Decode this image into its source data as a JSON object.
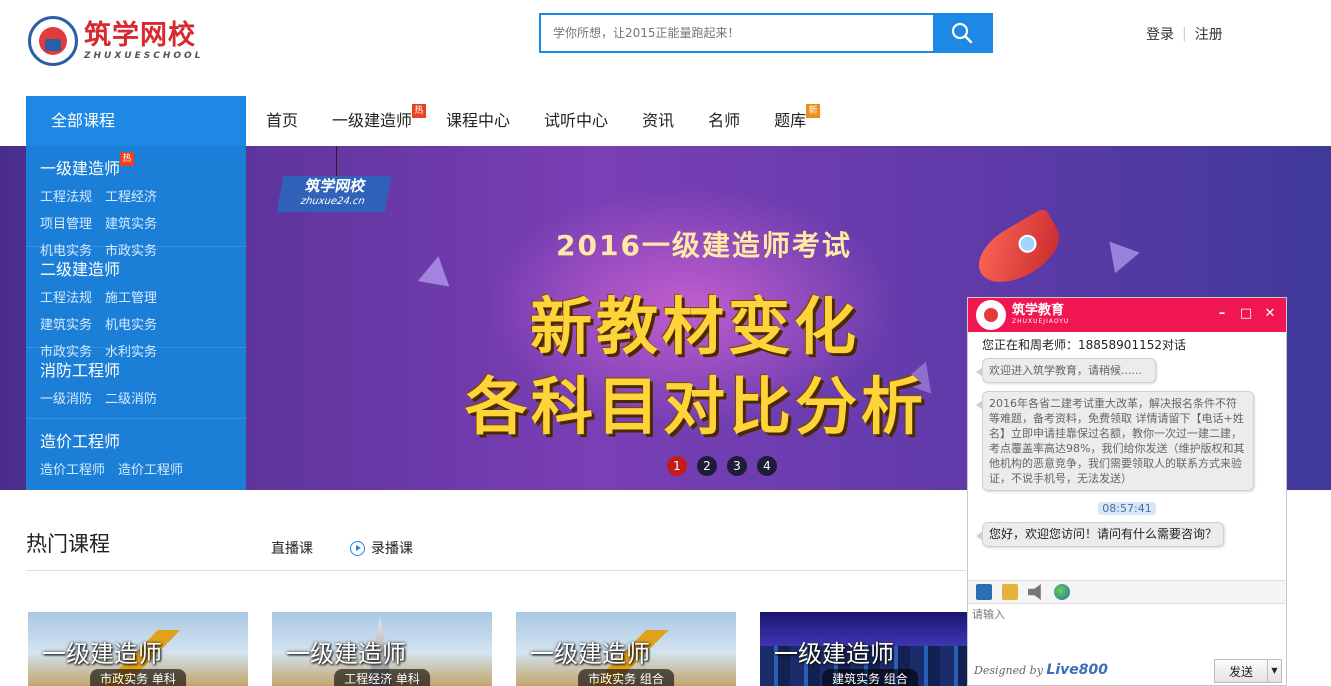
{
  "header": {
    "logo_cn": "筑学网校",
    "logo_en": "ZHUXUESCHOOL",
    "search_placeholder": "学你所想，让2015正能量跑起来！",
    "login": "登录",
    "register": "注册"
  },
  "nav": {
    "all_courses": "全部课程",
    "items": [
      {
        "label": "首页"
      },
      {
        "label": "一级建造师",
        "badge": "热"
      },
      {
        "label": "课程中心"
      },
      {
        "label": "试听中心"
      },
      {
        "label": "资讯"
      },
      {
        "label": "名师"
      },
      {
        "label": "题库",
        "badge": "新"
      }
    ]
  },
  "categories": [
    {
      "title": "一级建造师",
      "badge": "热",
      "links": [
        "工程法规",
        "工程经济",
        "项目管理",
        "建筑实务",
        "机电实务",
        "市政实务"
      ]
    },
    {
      "title": "二级建造师",
      "links": [
        "工程法规",
        "施工管理",
        "建筑实务",
        "机电实务",
        "市政实务",
        "水利实务"
      ]
    },
    {
      "title": "消防工程师",
      "links": [
        "一级消防",
        "二级消防"
      ]
    },
    {
      "title": "造价工程师",
      "links": [
        "造价工程师",
        "造价工程师"
      ]
    }
  ],
  "banner": {
    "logo_cn": "筑学网校",
    "logo_en": "zhuxue24.cn",
    "subtitle": "2016一级建造师考试",
    "headline_1": "新教材变化",
    "headline_2": "各科目对比分析",
    "dots": [
      "1",
      "2",
      "3",
      "4"
    ]
  },
  "hot": {
    "title": "热门课程",
    "tab_live": "直播课",
    "tab_recorded": "录播课",
    "cards": [
      {
        "title": "一级建造师",
        "sub": "市政实务 单科"
      },
      {
        "title": "一级建造师",
        "sub": "工程经济 单科"
      },
      {
        "title": "一级建造师",
        "sub": "市政实务 组合"
      },
      {
        "title": "一级建造师",
        "sub": "建筑实务 组合"
      }
    ]
  },
  "chat": {
    "brand_cn": "筑学教育",
    "brand_en": "ZHUXUEJIAOYU",
    "status": "您正在和周老师：18858901152对话",
    "msg_welcome": "欢迎进入筑学教育，请稍候......",
    "msg_notice": "2016年各省二建考试重大改革，解决报名条件不符等难题，备考资料，免费领取 详情请留下【电话+姓名】立即申请挂靠保过名额，教你一次过一建二建，考点覆盖率高达98%，我们给你发送（维护版权和其他机构的恶意竞争，我们需要领取人的联系方式来验证，不说手机号，无法发送）",
    "time": "08:57:41",
    "msg_greet": "您好，欢迎您访问！请问有什么需要咨询？",
    "input_placeholder": "请输入",
    "designed_by": "Designed by",
    "vendor": "Live800",
    "send": "发送"
  }
}
